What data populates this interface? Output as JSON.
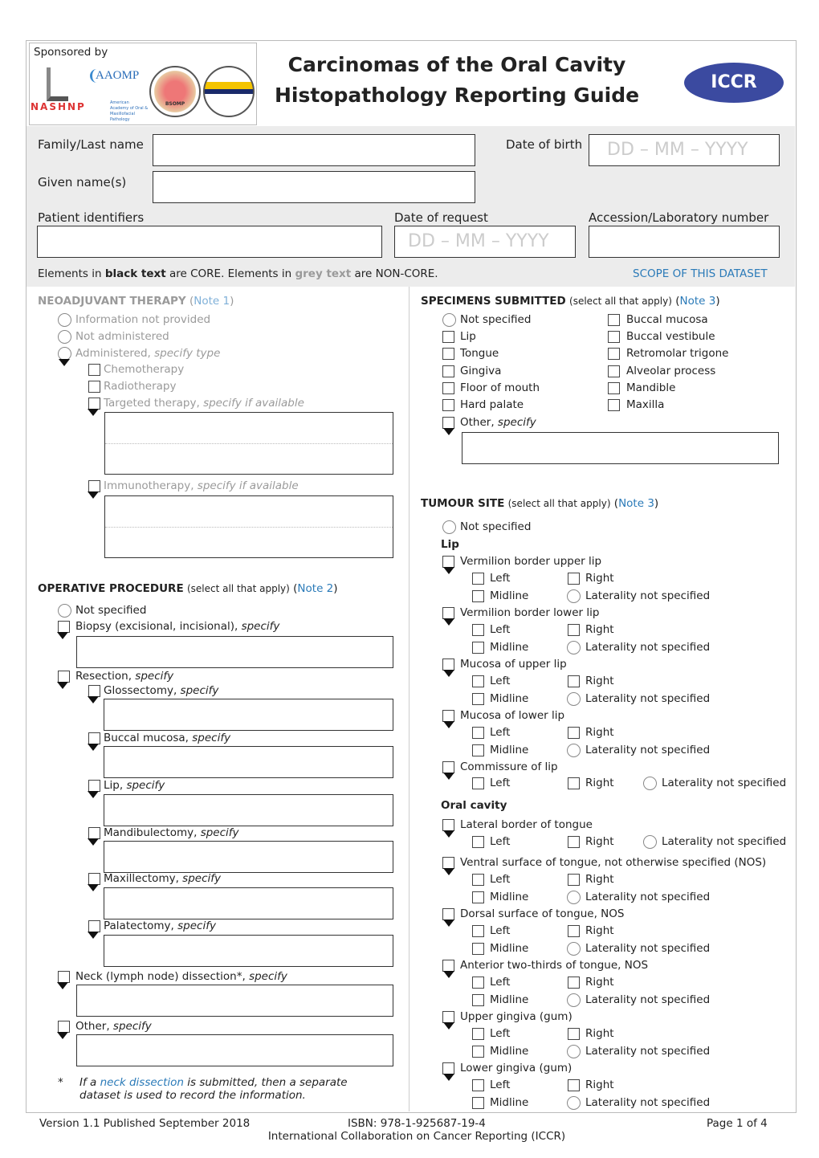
{
  "header": {
    "sponsored_by": "Sponsored by",
    "sponsor_logos": [
      "NASHNP",
      "AAOMP",
      "American Academy of Oral & Maxillofacial Pathology",
      "BSOMP",
      "IAOP"
    ],
    "title_line1": "Carcinomas of the Oral Cavity",
    "title_line2": "Histopathology Reporting Guide",
    "iccr_logo": "ICCR"
  },
  "patient": {
    "family_name_label": "Family/Last name",
    "given_names_label": "Given name(s)",
    "dob_label": "Date of birth",
    "dob_placeholder": "DD – MM – YYYY",
    "patient_identifiers_label": "Patient identifiers",
    "date_of_request_label": "Date of request",
    "date_of_request_placeholder": "DD – MM – YYYY",
    "accession_label": "Accession/Laboratory number",
    "family_name_value": "",
    "given_names_value": "",
    "patient_identifiers_value": "",
    "accession_value": ""
  },
  "legend": {
    "p1": "Elements in ",
    "black": "black text",
    "p2": " are CORE. Elements in ",
    "grey": "grey text",
    "p3": " are NON-CORE.",
    "scope_link": "SCOPE OF THIS DATASET"
  },
  "neoadjuvant": {
    "title": "NEOADJUVANT THERAPY",
    "note": "Note 1",
    "options": [
      {
        "label": "Information not provided"
      },
      {
        "label": "Not administered"
      },
      {
        "label": "Administered, ",
        "em": "specify type"
      }
    ],
    "types": [
      {
        "label": "Chemotherapy"
      },
      {
        "label": "Radiotherapy"
      },
      {
        "label": "Targeted therapy, ",
        "em": "specify if available"
      },
      {
        "label": "Immunotherapy, ",
        "em": "specify if available"
      }
    ]
  },
  "operative": {
    "title": "OPERATIVE PROCEDURE",
    "hint": "(select all that apply)",
    "note": "Note 2",
    "not_specified": "Not specified",
    "items": [
      {
        "label": "Biopsy (excisional, incisional), ",
        "em": "specify"
      },
      {
        "label": "Resection, ",
        "em": "specify"
      },
      {
        "label": "Glossectomy, ",
        "em": "specify"
      },
      {
        "label": "Buccal mucosa, ",
        "em": "specify"
      },
      {
        "label": "Lip, ",
        "em": "specify"
      },
      {
        "label": "Mandibulectomy, ",
        "em": "specify"
      },
      {
        "label": "Maxillectomy, ",
        "em": "specify"
      },
      {
        "label": "Palatectomy, ",
        "em": "specify"
      },
      {
        "label": "Neck (lymph node) dissection*, ",
        "em": "specify"
      },
      {
        "label": "Other, ",
        "em": "specify"
      }
    ],
    "footnote_star": "*",
    "footnote_p1": "If a ",
    "footnote_link": "neck dissection",
    "footnote_p2": " is submitted, then a separate",
    "footnote_line2": "dataset is used to record the information."
  },
  "specimens": {
    "title": "SPECIMENS SUBMITTED",
    "hint": "(select all that apply)",
    "note": "Note 3",
    "col1": [
      {
        "label": "Not specified"
      },
      {
        "label": "Lip"
      },
      {
        "label": "Tongue"
      },
      {
        "label": "Gingiva"
      },
      {
        "label": "Floor of mouth"
      },
      {
        "label": "Hard palate"
      },
      {
        "label": "Other, ",
        "em": "specify"
      }
    ],
    "col2": [
      {
        "label": "Buccal mucosa"
      },
      {
        "label": "Buccal vestibule"
      },
      {
        "label": "Retromolar trigone"
      },
      {
        "label": "Alveolar process"
      },
      {
        "label": "Mandible"
      },
      {
        "label": "Maxilla"
      }
    ]
  },
  "tumour_site": {
    "title": "TUMOUR SITE",
    "hint": "(select all that apply)",
    "note": "Note 3",
    "not_specified": "Not specified",
    "lip_heading": "Lip",
    "oral_heading": "Oral cavity",
    "lip_sites": [
      {
        "label": "Vermilion border upper lip",
        "options": [
          "Left",
          "Right",
          "Midline",
          "Laterality not specified"
        ]
      },
      {
        "label": "Vermilion border lower lip",
        "options": [
          "Left",
          "Right",
          "Midline",
          "Laterality not specified"
        ]
      },
      {
        "label": "Mucosa of upper lip",
        "options": [
          "Left",
          "Right",
          "Midline",
          "Laterality not specified"
        ]
      },
      {
        "label": "Mucosa of lower lip",
        "options": [
          "Left",
          "Right",
          "Midline",
          "Laterality not specified"
        ]
      },
      {
        "label": "Commissure of lip",
        "options": [
          "Left",
          "Right",
          "Laterality not specified"
        ]
      }
    ],
    "oral_sites": [
      {
        "label": "Lateral border of tongue",
        "options": [
          "Left",
          "Right",
          "Laterality not specified"
        ]
      },
      {
        "label": "Ventral surface of tongue, not otherwise specified (NOS)",
        "options": [
          "Left",
          "Right",
          "Midline",
          "Laterality not specified"
        ]
      },
      {
        "label": "Dorsal surface of tongue, NOS",
        "options": [
          "Left",
          "Right",
          "Midline",
          "Laterality not specified"
        ]
      },
      {
        "label": "Anterior two-thirds of tongue, NOS",
        "options": [
          "Left",
          "Right",
          "Midline",
          "Laterality not specified"
        ]
      },
      {
        "label": "Upper gingiva (gum)",
        "options": [
          "Left",
          "Right",
          "Midline",
          "Laterality not specified"
        ]
      },
      {
        "label": "Lower gingiva (gum)",
        "options": [
          "Left",
          "Right",
          "Midline",
          "Laterality not specified"
        ]
      }
    ]
  },
  "footer": {
    "version": "Version 1.1 Published September 2018",
    "isbn": "ISBN: 978-1-925687-19-4",
    "page": "Page 1 of 4",
    "org": "International Collaboration on Cancer Reporting (ICCR)"
  },
  "colors": {
    "link": "#2a7ab8",
    "grey_text": "#9a9a9a",
    "band": "#ececec",
    "iccr_blue": "#3b4aa0"
  }
}
